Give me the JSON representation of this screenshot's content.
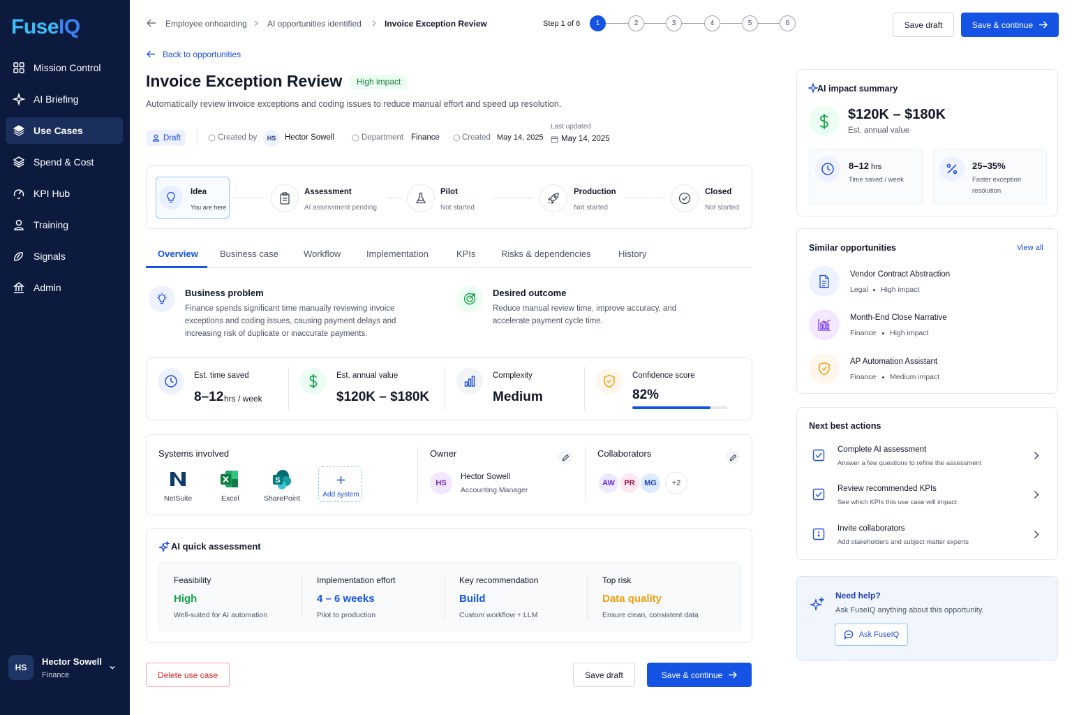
{
  "brand": {
    "name": "FuseIQ"
  },
  "nav": [
    {
      "label": "Mission Control",
      "icon": "grid-icon"
    },
    {
      "label": "AI Briefing",
      "icon": "sparkle-icon"
    },
    {
      "label": "Use Cases",
      "icon": "layers-icon",
      "active": true
    },
    {
      "label": "Spend & Cost",
      "icon": "stack-icon"
    },
    {
      "label": "KPI Hub",
      "icon": "gauge-icon"
    },
    {
      "label": "Training",
      "icon": "person-icon"
    },
    {
      "label": "Signals",
      "icon": "signal-icon"
    },
    {
      "label": "Admin",
      "icon": "building-icon"
    }
  ],
  "user": {
    "initials": "HS",
    "name": "Hector Sowell",
    "dept": "Finance"
  },
  "breadcrumb": [
    "Employee onhoarding",
    "AI opportunities identified",
    "Invoice Exception Review"
  ],
  "stepper": {
    "label": "Step 1 of 6",
    "steps": [
      "1",
      "2",
      "3",
      "4",
      "5",
      "6"
    ],
    "current": 1
  },
  "header_actions": {
    "save_draft": "Save draft",
    "save_continue": "Save & continue"
  },
  "back_link": "Back to opportunities",
  "page": {
    "title": "Invoice Exception Review",
    "impact_badge": "High impact",
    "description": "Automatically review invoice exceptions and coding issues to reduce manual effort and speed up resolution."
  },
  "meta": {
    "status": "Draft",
    "created_by_label": "Created by",
    "creator_initials": "HS",
    "creator_name": "Hector Sowell",
    "department_label": "Department",
    "department": "Finance",
    "created_label": "Created",
    "created_date": "May 14, 2025",
    "last_updated_label": "Last updated",
    "last_updated": "May 14, 2025"
  },
  "lifecycle": [
    {
      "title": "Idea",
      "sub": "You are here",
      "icon": "lightbulb-icon"
    },
    {
      "title": "Assessment",
      "sub": "AI assessment pending",
      "icon": "clipboard-icon"
    },
    {
      "title": "Pilot",
      "sub": "Not started",
      "icon": "flask-icon"
    },
    {
      "title": "Production",
      "sub": "Not started",
      "icon": "rocket-icon"
    },
    {
      "title": "Closed",
      "sub": "Not started",
      "icon": "check-circle-icon"
    }
  ],
  "tabs": [
    "Overview",
    "Business case",
    "Workflow",
    "Implementation",
    "KPIs",
    "Risks & dependencies",
    "History"
  ],
  "business_problem": {
    "title": "Business problem",
    "lines": [
      "Finance spends significant time manually reviewing invoice",
      "exceptions and coding issues, causing payment delays and",
      "increasing risk of duplicate or inaccurate payments."
    ]
  },
  "desired_outcome": {
    "title": "Desired outcome",
    "lines": [
      "Reduce manual review time, improve accuracy, and",
      "accelerate payment cycle time."
    ]
  },
  "metrics": {
    "time_label": "Est. time saved",
    "time_value": "8–12",
    "time_unit": "hrs / week",
    "value_label": "Est. annual value",
    "value_value": "$120K – $180K",
    "complexity_label": "Complexity",
    "complexity_value": "Medium",
    "confidence_label": "Confidence score",
    "confidence_value": "82%",
    "confidence_fraction": 0.82
  },
  "systems": {
    "title": "Systems involved",
    "items": [
      {
        "name": "NetSuite"
      },
      {
        "name": "Excel"
      },
      {
        "name": "SharePoint"
      }
    ],
    "add_label": "Add system"
  },
  "owner": {
    "title": "Owner",
    "initials": "HS",
    "name": "Hector Sowell",
    "role": "Accounting Manager"
  },
  "collaborators": {
    "title": "Collaborators",
    "avatars": [
      "AW",
      "PR",
      "MG"
    ],
    "more": "+2"
  },
  "quick_assessment": {
    "title": "AI quick assessment",
    "items": [
      {
        "label": "Feasibility",
        "value": "High",
        "sub": "Well-suited for AI automation",
        "color": "#16a34a"
      },
      {
        "label": "Implementation effort",
        "value": "4 – 6 weeks",
        "sub": "Pilot to production",
        "color": "#1453e4"
      },
      {
        "label": "Key recommendation",
        "value": "Build",
        "sub": "Custom workflow + LLM",
        "color": "#1453e4"
      },
      {
        "label": "Top risk",
        "value": "Data quality",
        "sub": "Ensure clean, consistent data",
        "color": "#f59e0b"
      }
    ]
  },
  "footer": {
    "delete": "Delete use case",
    "save_draft": "Save draft",
    "save_continue": "Save & continue"
  },
  "impact_summary": {
    "title": "AI impact summary",
    "value": "$120K – $180K",
    "value_label": "Est. annual value",
    "time_value": "8–12",
    "time_unit": "hrs",
    "time_label": "Time saved / week",
    "faster_value": "25–35%",
    "faster_label_1": "Faster exception",
    "faster_label_2": "resolution"
  },
  "similar": {
    "title": "Similar opportunities",
    "view_all": "View all",
    "items": [
      {
        "name": "Vendor Contract Abstraction",
        "dept": "Legal",
        "impact": "High impact",
        "icon": "document-icon",
        "color": "#1453e4",
        "bg": "#eef2ff"
      },
      {
        "name": "Month-End Close Narrative",
        "dept": "Finance",
        "impact": "High impact",
        "icon": "chart-icon",
        "color": "#7c3aed",
        "bg": "#f3e8ff"
      },
      {
        "name": "AP Automation Assistant",
        "dept": "Finance",
        "impact": "Medium impact",
        "icon": "shield-icon",
        "color": "#f59e0b",
        "bg": "#fff7ed"
      }
    ]
  },
  "next_actions": {
    "title": "Next best actions",
    "items": [
      {
        "title": "Complete AI assessment",
        "sub": "Answer a few questions to refine the assessment"
      },
      {
        "title": "Review recommended KPIs",
        "sub": "See which KPIs this use case will impact"
      },
      {
        "title": "Invite collaborators",
        "sub": "Add stakeholders and subject matter experts"
      }
    ]
  },
  "help": {
    "title": "Need help?",
    "sub": "Ask FuseIQ anything about this opportunity.",
    "button": "Ask FuseIQ"
  },
  "colors": {
    "primary": "#1453e4",
    "sidebar": "#0b1a3d",
    "success": "#16a34a",
    "warning": "#f59e0b"
  }
}
